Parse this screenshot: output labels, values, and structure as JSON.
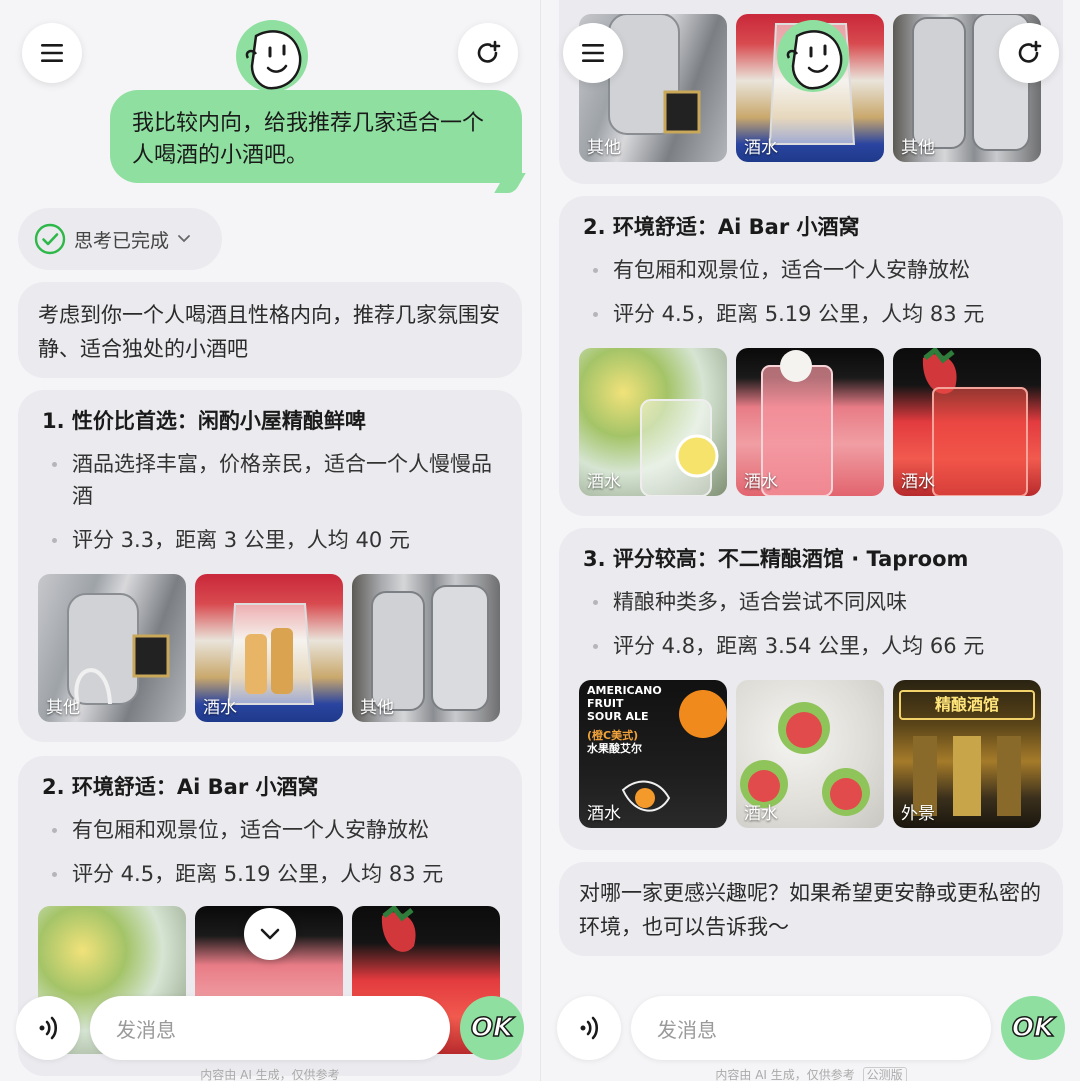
{
  "colors": {
    "accent": "#8fe0a0",
    "card_bg": "#ebebef",
    "check_green": "#2fb84a"
  },
  "left": {
    "user_message": "我比较内向，给我推荐几家适合一个人喝酒的小酒吧。",
    "thinking_label": "思考已完成",
    "intro": "考虑到你一个人喝酒且性格内向，推荐几家氛围安静、适合独处的小酒吧",
    "items": [
      {
        "title": "1. 性价比首选：闲酌小屋精酿鲜啤",
        "bullets": [
          "酒品选择丰富，价格亲民，适合一个人慢慢品酒",
          "评分 3.3，距离 3 公里，人均 40 元"
        ],
        "images": [
          {
            "tag": "其他"
          },
          {
            "tag": "酒水"
          },
          {
            "tag": "其他"
          }
        ]
      },
      {
        "title": "2. 环境舒适：Ai Bar 小酒窝",
        "bullets": [
          "有包厢和观景位，适合一个人安静放松",
          "评分 4.5，距离 5.19 公里，人均 83 元"
        ],
        "images": [
          {
            "tag": ""
          },
          {
            "tag": ""
          },
          {
            "tag": ""
          }
        ]
      }
    ],
    "input_placeholder": "发消息",
    "ok_label": "OK",
    "footer_note": "内容由 AI 生成，仅供参考"
  },
  "right": {
    "top_images": [
      {
        "tag": "其他"
      },
      {
        "tag": "酒水"
      },
      {
        "tag": "其他"
      }
    ],
    "items": [
      {
        "title": "2. 环境舒适：Ai Bar 小酒窝",
        "bullets": [
          "有包厢和观景位，适合一个人安静放松",
          "评分 4.5，距离 5.19 公里，人均 83 元"
        ],
        "images": [
          {
            "tag": "酒水"
          },
          {
            "tag": "酒水"
          },
          {
            "tag": "酒水"
          }
        ]
      },
      {
        "title": "3. 评分较高：不二精酿酒馆 · Taproom",
        "bullets": [
          "精酿种类多，适合尝试不同风味",
          "评分 4.8，距离 3.54 公里，人均 66 元"
        ],
        "images": [
          {
            "tag": "酒水"
          },
          {
            "tag": "酒水"
          },
          {
            "tag": "外景"
          }
        ]
      }
    ],
    "closing": "对哪一家更感兴趣呢？如果希望更安静或更私密的环境，也可以告诉我～",
    "input_placeholder": "发消息",
    "ok_label": "OK",
    "footer_note": "内容由 AI 生成，仅供参考",
    "footer_badge": "公测版"
  },
  "photo_text": {
    "sour_top": "AMERICANO",
    "sour_mid1": "FRUIT",
    "sour_mid2": "SOUR ALE",
    "sour_cn1": "(橙C美式)",
    "sour_cn2": "水果酸艾尔",
    "bar_sign": "精酿酒馆"
  }
}
